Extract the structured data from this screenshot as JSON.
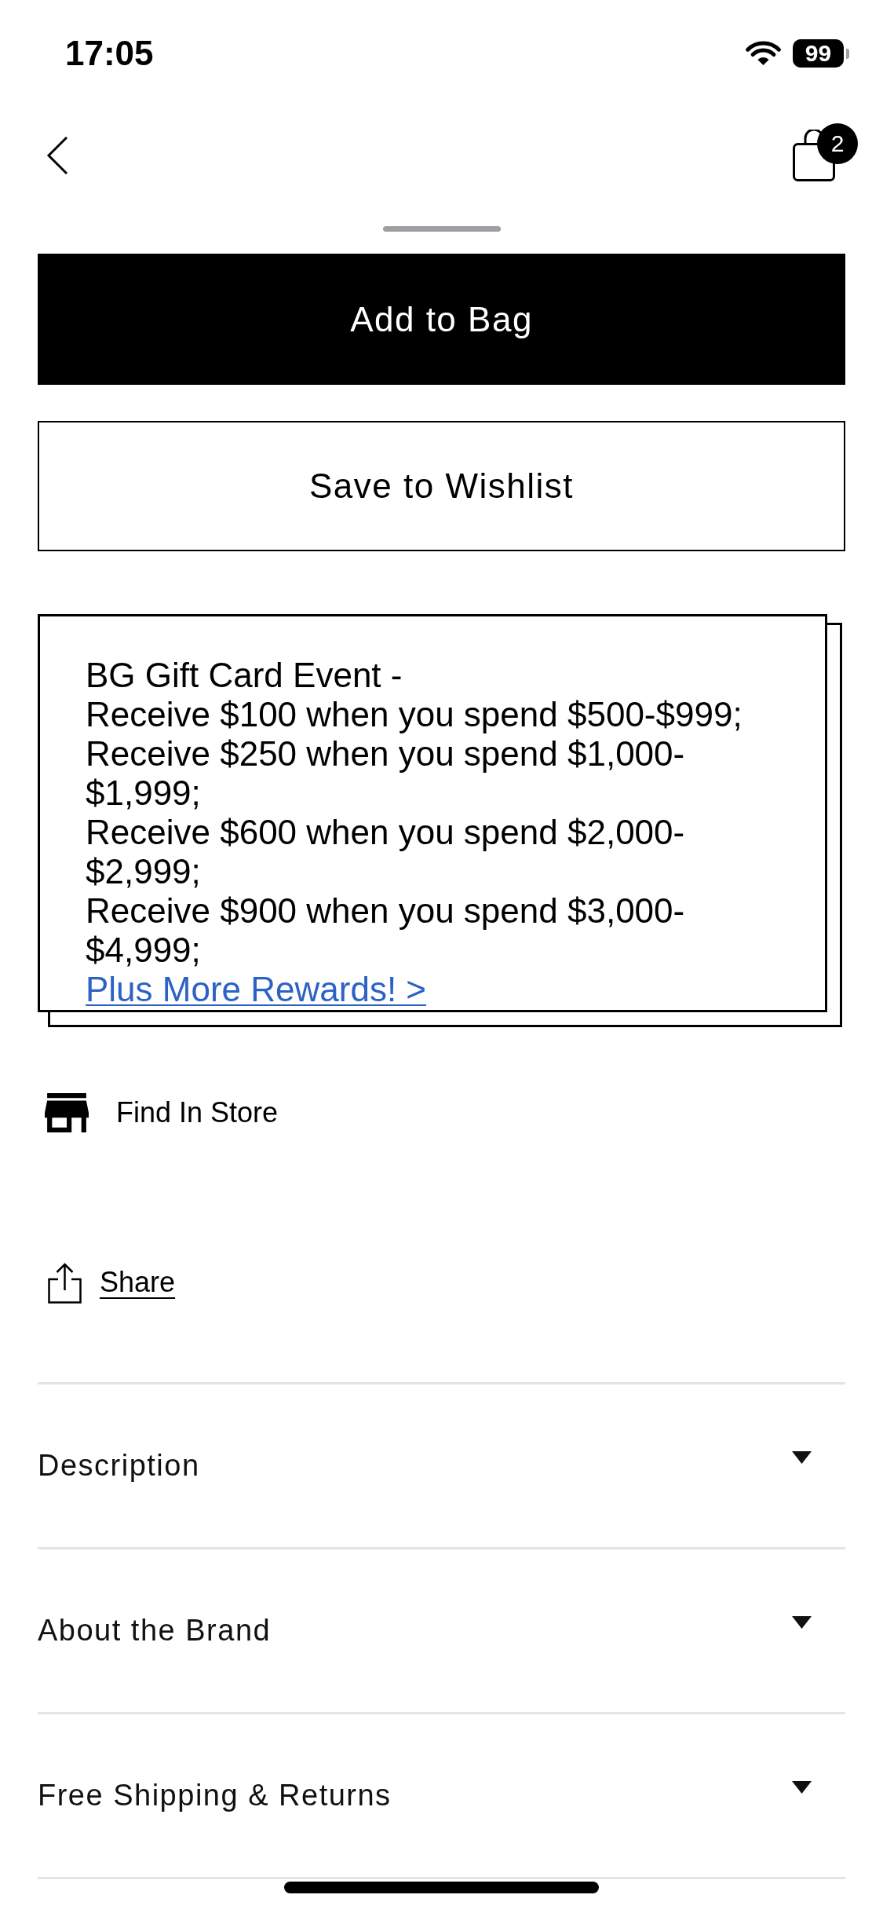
{
  "status_bar": {
    "time": "17:05",
    "battery": "99"
  },
  "nav": {
    "bag_count": "2"
  },
  "buttons": [
    {
      "kind": "primary",
      "label": "Add to Bag"
    },
    {
      "kind": "secondary",
      "label": "Save to Wishlist"
    }
  ],
  "promo": {
    "title": "BG Gift Card Event -",
    "offers": [
      "Receive $100 when you spend $500-$999;",
      "Receive $250 when you spend $1,000-$1,999;",
      "Receive $600 when you spend $2,000-$2,999;",
      "Receive $900 when you spend $3,000-$4,999;"
    ],
    "link": "Plus More Rewards! >"
  },
  "actions": [
    {
      "kind": "store",
      "label": "Find In Store"
    },
    {
      "kind": "share",
      "label": "Share"
    }
  ],
  "accordion": [
    {
      "label": "Description",
      "expanded": false
    },
    {
      "label": "About the Brand",
      "expanded": false
    },
    {
      "label": "Free Shipping & Returns",
      "expanded": false
    }
  ]
}
